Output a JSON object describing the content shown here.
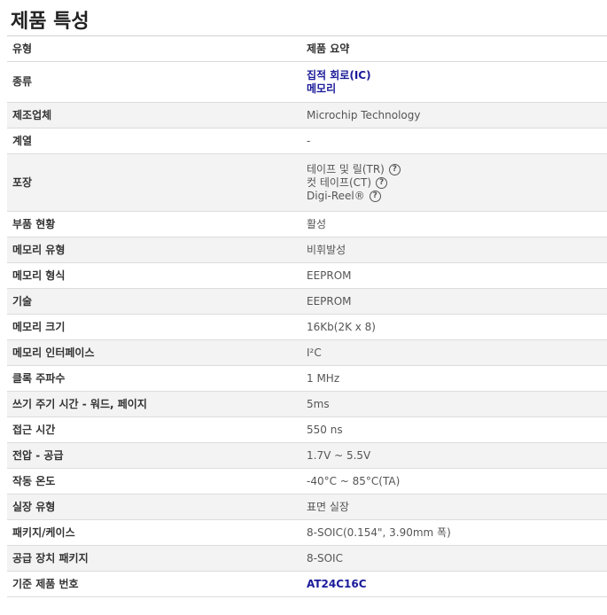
{
  "title": "제품 특성",
  "header": {
    "type": "유형",
    "summary": "제품 요약"
  },
  "rows": [
    {
      "label": "종류",
      "links": [
        "집적 회로(IC)",
        "메모리"
      ]
    },
    {
      "label": "제조업체",
      "value": "Microchip Technology"
    },
    {
      "label": "계열",
      "value": "-"
    },
    {
      "label": "포장",
      "packaging": [
        "테이프 및 릴(TR)",
        "컷 테이프(CT)",
        "Digi-Reel®"
      ],
      "help_icon": "question-circle-icon",
      "help_glyph": "?"
    },
    {
      "label": "부품 현황",
      "value": "활성"
    },
    {
      "label": "메모리 유형",
      "value": "비휘발성"
    },
    {
      "label": "메모리 형식",
      "value": "EEPROM"
    },
    {
      "label": "기술",
      "value": "EEPROM"
    },
    {
      "label": "메모리 크기",
      "value": "16Kb(2K x 8)"
    },
    {
      "label": "메모리 인터페이스",
      "value": "I²C"
    },
    {
      "label": "클록 주파수",
      "value": "1 MHz"
    },
    {
      "label": "쓰기 주기 시간 - 워드, 페이지",
      "value": "5ms"
    },
    {
      "label": "접근 시간",
      "value": "550 ns"
    },
    {
      "label": "전압 - 공급",
      "value": "1.7V ~ 5.5V"
    },
    {
      "label": "작동 온도",
      "value": "-40°C ~ 85°C(TA)"
    },
    {
      "label": "실장 유형",
      "value": "표면 실장"
    },
    {
      "label": "패키지/케이스",
      "value": "8-SOIC(0.154\", 3.90mm 폭)"
    },
    {
      "label": "공급 장치 패키지",
      "value": "8-SOIC"
    },
    {
      "label": "기준 제품 번호",
      "link": "AT24C16C"
    }
  ],
  "colors": {
    "link": "#1b1b9a",
    "alt_row": "#f3f3f3",
    "border": "#dcdcdc"
  }
}
